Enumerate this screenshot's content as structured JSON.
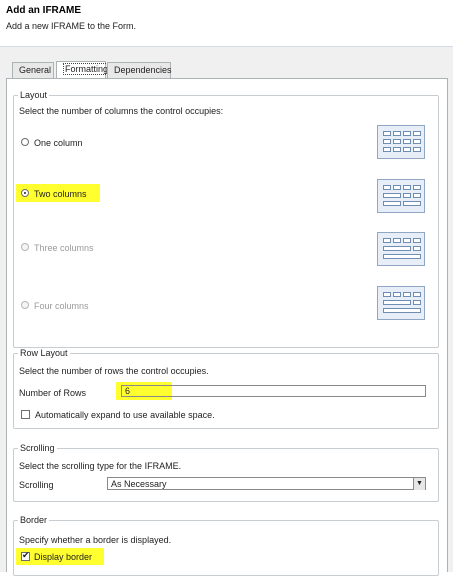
{
  "header": {
    "title": "Add an IFRAME",
    "subtitle": "Add a new IFRAME to the Form."
  },
  "tabs": [
    {
      "label": "General",
      "active": false
    },
    {
      "label": "Formatting",
      "active": true
    },
    {
      "label": "Dependencies",
      "active": false
    }
  ],
  "layout": {
    "legend": "Layout",
    "description": "Select the number of columns the control occupies:",
    "options": [
      {
        "label": "One column",
        "checked": false,
        "enabled": true
      },
      {
        "label": "Two columns",
        "checked": true,
        "enabled": true
      },
      {
        "label": "Three columns",
        "checked": false,
        "enabled": false
      },
      {
        "label": "Four columns",
        "checked": false,
        "enabled": false
      }
    ]
  },
  "row_layout": {
    "legend": "Row Layout",
    "description": "Select the number of rows the control occupies.",
    "rows_label": "Number of Rows",
    "rows_value": "6",
    "auto_expand_label": "Automatically expand to use available space.",
    "auto_expand_checked": false
  },
  "scrolling": {
    "legend": "Scrolling",
    "description": "Select the scrolling type for the IFRAME.",
    "label": "Scrolling",
    "value": "As Necessary"
  },
  "border": {
    "legend": "Border",
    "description": "Specify whether a border is displayed.",
    "display_label": "Display border",
    "display_checked": true
  },
  "colors": {
    "highlight": "#ffff30",
    "panel_bg": "#f0f0f0",
    "icon_border": "#6f8db2"
  }
}
